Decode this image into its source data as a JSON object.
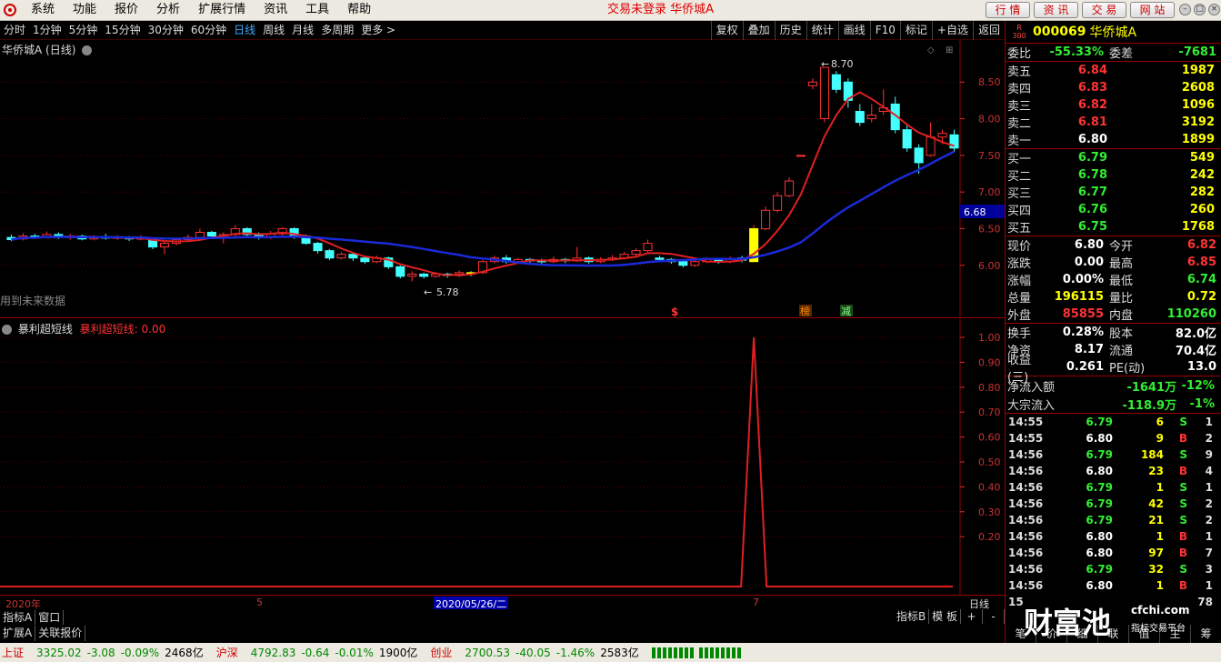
{
  "menu": {
    "items": [
      "系统",
      "功能",
      "报价",
      "分析",
      "扩展行情",
      "资讯",
      "工具",
      "帮助"
    ],
    "status": "交易未登录  华侨城A",
    "top_buttons": [
      "行 情",
      "资 讯",
      "交 易",
      "网 站"
    ]
  },
  "periods": [
    "分时",
    "1分钟",
    "5分钟",
    "15分钟",
    "30分钟",
    "60分钟",
    "日线",
    "周线",
    "月线",
    "多周期",
    "更多 >"
  ],
  "active_period": "日线",
  "tools": [
    "复权",
    "叠加",
    "历史",
    "统计",
    "画线",
    "F10",
    "标记",
    "+自选",
    "返回"
  ],
  "main_chart": {
    "title": "华侨城A (日线)",
    "future_note": "用到未来数据",
    "price_high_label": "8.70",
    "price_low_label": "5.78",
    "current_price_tag": "6.68",
    "markers": {
      "s": "$",
      "bang": "榜",
      "jian": "减"
    }
  },
  "indicator": {
    "title": "暴利超短线",
    "value_label": "暴利超短线: 0.00"
  },
  "date_axis": {
    "year": "2020年",
    "m5": "5",
    "selected": "2020/05/26/二",
    "m7": "7",
    "period": "日线"
  },
  "bottom_tabs": [
    "指标A",
    "窗口"
  ],
  "bottom_tabs2": [
    "扩展A",
    "关联报价"
  ],
  "bottom_right_tabs": [
    "指标B",
    "模 板",
    "+",
    "-"
  ],
  "status_bar": {
    "sh_label": "上证",
    "sh_price": "3325.02",
    "sh_chg": "-3.08",
    "sh_pct": "-0.09%",
    "sh_amt": "2468亿",
    "sz_label": "沪深",
    "sz_price": "4792.83",
    "sz_chg": "-0.64",
    "sz_pct": "-0.01%",
    "sz_amt": "1900亿",
    "cy_label": "创业",
    "cy_price": "2700.53",
    "cy_chg": "-40.05",
    "cy_pct": "-1.46%",
    "cy_amt": "2583亿"
  },
  "stock": {
    "badge1": "R",
    "badge2": "300",
    "code": "000069",
    "name": "华侨城A",
    "weibi_label": "委比",
    "weibi": "-55.33%",
    "weicha_label": "委差",
    "weicha": "-7681",
    "asks": [
      {
        "label": "卖五",
        "price": "6.84",
        "vol": "1987"
      },
      {
        "label": "卖四",
        "price": "6.83",
        "vol": "2608"
      },
      {
        "label": "卖三",
        "price": "6.82",
        "vol": "1096"
      },
      {
        "label": "卖二",
        "price": "6.81",
        "vol": "3192"
      },
      {
        "label": "卖一",
        "price": "6.80",
        "vol": "1899"
      }
    ],
    "bids": [
      {
        "label": "买一",
        "price": "6.79",
        "vol": "549"
      },
      {
        "label": "买二",
        "price": "6.78",
        "vol": "242"
      },
      {
        "label": "买三",
        "price": "6.77",
        "vol": "282"
      },
      {
        "label": "买四",
        "price": "6.76",
        "vol": "260"
      },
      {
        "label": "买五",
        "price": "6.75",
        "vol": "1768"
      }
    ],
    "quote": [
      {
        "l1": "现价",
        "v1": "6.80",
        "c1": "white",
        "l2": "今开",
        "v2": "6.82",
        "c2": "red"
      },
      {
        "l1": "涨跌",
        "v1": "0.00",
        "c1": "white",
        "l2": "最高",
        "v2": "6.85",
        "c2": "red"
      },
      {
        "l1": "涨幅",
        "v1": "0.00%",
        "c1": "white",
        "l2": "最低",
        "v2": "6.74",
        "c2": "green"
      },
      {
        "l1": "总量",
        "v1": "196115",
        "c1": "yellow",
        "l2": "量比",
        "v2": "0.72",
        "c2": "yellow"
      },
      {
        "l1": "外盘",
        "v1": "85855",
        "c1": "red",
        "l2": "内盘",
        "v2": "110260",
        "c2": "green"
      }
    ],
    "fund": [
      {
        "l1": "换手",
        "v1": "0.28%",
        "l2": "股本",
        "v2": "82.0亿"
      },
      {
        "l1": "净资",
        "v1": "8.17",
        "l2": "流通",
        "v2": "70.4亿"
      },
      {
        "l1": "收益(三)",
        "v1": "0.261",
        "l2": "PE(动)",
        "v2": "13.0"
      }
    ],
    "flows": [
      {
        "label": "净流入额",
        "v1": "-1641万",
        "v2": "-12%"
      },
      {
        "label": "大宗流入",
        "v1": "-118.9万",
        "v2": "-1%"
      }
    ],
    "ticks": [
      {
        "t": "14:55",
        "p": "6.79",
        "pc": "green",
        "v": "6",
        "d": "S",
        "dc": "green",
        "n": "1"
      },
      {
        "t": "14:55",
        "p": "6.80",
        "pc": "white",
        "v": "9",
        "d": "B",
        "dc": "red",
        "n": "2"
      },
      {
        "t": "14:56",
        "p": "6.79",
        "pc": "green",
        "v": "184",
        "d": "S",
        "dc": "green",
        "n": "9"
      },
      {
        "t": "14:56",
        "p": "6.80",
        "pc": "white",
        "v": "23",
        "d": "B",
        "dc": "red",
        "n": "4"
      },
      {
        "t": "14:56",
        "p": "6.79",
        "pc": "green",
        "v": "1",
        "d": "S",
        "dc": "green",
        "n": "1"
      },
      {
        "t": "14:56",
        "p": "6.79",
        "pc": "green",
        "v": "42",
        "d": "S",
        "dc": "green",
        "n": "2"
      },
      {
        "t": "14:56",
        "p": "6.79",
        "pc": "green",
        "v": "21",
        "d": "S",
        "dc": "green",
        "n": "2"
      },
      {
        "t": "14:56",
        "p": "6.80",
        "pc": "white",
        "v": "1",
        "d": "B",
        "dc": "red",
        "n": "1"
      },
      {
        "t": "14:56",
        "p": "6.80",
        "pc": "white",
        "v": "97",
        "d": "B",
        "dc": "red",
        "n": "7"
      },
      {
        "t": "14:56",
        "p": "6.79",
        "pc": "green",
        "v": "32",
        "d": "S",
        "dc": "green",
        "n": "3"
      },
      {
        "t": "14:56",
        "p": "6.80",
        "pc": "white",
        "v": "1",
        "d": "B",
        "dc": "red",
        "n": "1"
      }
    ],
    "last_tick_n": "78"
  },
  "watermark": {
    "main": "财富池",
    "site": "cfchi.com",
    "sub": "指标交易平台"
  },
  "right_bottom_tabs": [
    "笔",
    "价",
    "细",
    "联",
    "值",
    "主",
    "筹"
  ],
  "chart_data": {
    "type": "candlestick",
    "y_ticks_main": [
      "8.50",
      "8.00",
      "7.50",
      "7.00",
      "6.50",
      "6.00"
    ],
    "y_ticks_ind": [
      "1.00",
      "0.90",
      "0.80",
      "0.70",
      "0.60",
      "0.50",
      "0.40",
      "0.30",
      "0.20"
    ],
    "ylim": [
      5.6,
      8.9
    ],
    "candles": [
      [
        6.38,
        6.35,
        6.42,
        6.33
      ],
      [
        6.36,
        6.4,
        6.44,
        6.34
      ],
      [
        6.4,
        6.38,
        6.43,
        6.36
      ],
      [
        6.38,
        6.42,
        6.46,
        6.37
      ],
      [
        6.42,
        6.38,
        6.45,
        6.36
      ],
      [
        6.38,
        6.4,
        6.43,
        6.35
      ],
      [
        6.4,
        6.36,
        6.42,
        6.34
      ],
      [
        6.36,
        6.39,
        6.41,
        6.34
      ],
      [
        6.39,
        6.37,
        6.43,
        6.35
      ],
      [
        6.37,
        6.38,
        6.41,
        6.35
      ],
      [
        6.38,
        6.36,
        6.4,
        6.33
      ],
      [
        6.36,
        6.37,
        6.41,
        6.34
      ],
      [
        6.37,
        6.25,
        6.38,
        6.22
      ],
      [
        6.25,
        6.3,
        6.33,
        6.15
      ],
      [
        6.3,
        6.35,
        6.38,
        6.27
      ],
      [
        6.35,
        6.38,
        6.42,
        6.32
      ],
      [
        6.38,
        6.45,
        6.5,
        6.36
      ],
      [
        6.45,
        6.4,
        6.47,
        6.37
      ],
      [
        6.4,
        6.42,
        6.45,
        6.3
      ],
      [
        6.42,
        6.5,
        6.55,
        6.4
      ],
      [
        6.5,
        6.42,
        6.52,
        6.39
      ],
      [
        6.42,
        6.38,
        6.45,
        6.35
      ],
      [
        6.38,
        6.43,
        6.47,
        6.36
      ],
      [
        6.43,
        6.5,
        6.52,
        6.4
      ],
      [
        6.5,
        6.4,
        6.52,
        6.36
      ],
      [
        6.4,
        6.3,
        6.42,
        6.28
      ],
      [
        6.3,
        6.2,
        6.32,
        6.16
      ],
      [
        6.2,
        6.1,
        6.22,
        6.07
      ],
      [
        6.1,
        6.15,
        6.18,
        6.08
      ],
      [
        6.15,
        6.1,
        6.17,
        6.06
      ],
      [
        6.1,
        6.05,
        6.12,
        6.02
      ],
      [
        6.05,
        6.1,
        6.13,
        6.03
      ],
      [
        6.1,
        5.98,
        6.12,
        5.95
      ],
      [
        5.98,
        5.85,
        6.0,
        5.82
      ],
      [
        5.85,
        5.88,
        5.92,
        5.78
      ],
      [
        5.88,
        5.85,
        5.9,
        5.82
      ],
      [
        5.85,
        5.88,
        5.91,
        5.83
      ],
      [
        5.88,
        5.86,
        5.9,
        5.83
      ],
      [
        5.86,
        5.9,
        5.93,
        5.84
      ],
      [
        5.9,
        5.88,
        5.92,
        5.85
      ],
      [
        5.9,
        6.05,
        6.07,
        5.88
      ],
      [
        6.05,
        6.1,
        6.13,
        6.03
      ],
      [
        6.1,
        6.05,
        6.14,
        6.02
      ],
      [
        6.05,
        6.08,
        6.1,
        6.03
      ],
      [
        6.08,
        6.06,
        6.1,
        6.03
      ],
      [
        6.06,
        6.05,
        6.09,
        6.02
      ],
      [
        6.05,
        6.08,
        6.12,
        6.03
      ],
      [
        6.08,
        6.06,
        6.1,
        6.03
      ],
      [
        6.06,
        6.1,
        6.25,
        6.05
      ],
      [
        6.1,
        6.05,
        6.12,
        6.02
      ],
      [
        6.05,
        6.08,
        6.11,
        6.03
      ],
      [
        6.08,
        6.1,
        6.14,
        6.06
      ],
      [
        6.1,
        6.15,
        6.18,
        6.08
      ],
      [
        6.15,
        6.2,
        6.23,
        6.13
      ],
      [
        6.2,
        6.3,
        6.35,
        6.18
      ],
      [
        6.1,
        6.08,
        6.13,
        6.05
      ],
      [
        6.08,
        6.05,
        6.1,
        6.02
      ],
      [
        6.05,
        6.0,
        6.07,
        5.97
      ],
      [
        6.0,
        6.05,
        6.08,
        5.98
      ],
      [
        6.05,
        6.08,
        6.11,
        6.03
      ],
      [
        6.08,
        6.05,
        6.1,
        6.02
      ],
      [
        6.05,
        6.08,
        6.12,
        6.03
      ],
      [
        6.1,
        6.07,
        6.13,
        6.04
      ],
      [
        6.05,
        6.5,
        6.55,
        6.05
      ],
      [
        6.5,
        6.75,
        6.8,
        6.48
      ],
      [
        6.75,
        6.95,
        7.0,
        6.72
      ],
      [
        6.95,
        7.15,
        7.2,
        6.93
      ],
      [
        7.5,
        7.5,
        7.5,
        7.5
      ],
      [
        8.45,
        8.5,
        8.55,
        8.4
      ],
      [
        8.0,
        8.7,
        8.7,
        7.95
      ],
      [
        8.6,
        8.4,
        8.65,
        8.35
      ],
      [
        8.5,
        8.25,
        8.55,
        8.15
      ],
      [
        8.1,
        7.95,
        8.2,
        7.9
      ],
      [
        8.0,
        8.05,
        8.2,
        7.95
      ],
      [
        8.1,
        8.15,
        8.4,
        8.05
      ],
      [
        8.2,
        7.85,
        8.3,
        7.8
      ],
      [
        7.85,
        7.6,
        7.92,
        7.55
      ],
      [
        7.6,
        7.4,
        7.65,
        7.25
      ],
      [
        7.5,
        7.75,
        7.95,
        7.48
      ],
      [
        7.75,
        7.8,
        7.85,
        7.65
      ],
      [
        7.78,
        7.6,
        7.85,
        7.55
      ]
    ],
    "indicator_values": "single spike to 1.00 near early July, 0 elsewhere"
  }
}
